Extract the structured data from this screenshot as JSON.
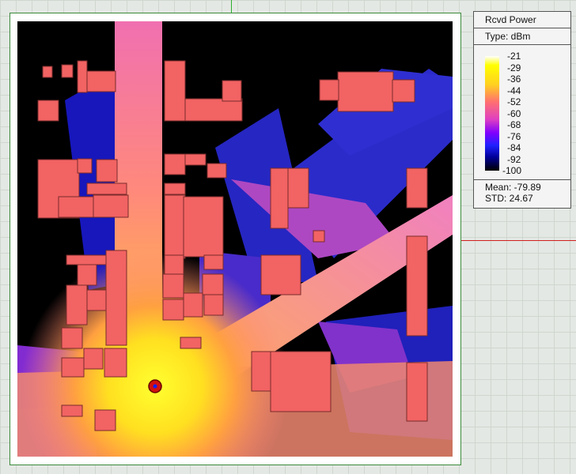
{
  "legend": {
    "title": "Rcvd Power",
    "type_label": "Type: dBm",
    "ticks": [
      "-21",
      "-29",
      "-36",
      "-44",
      "-52",
      "-60",
      "-68",
      "-76",
      "-84",
      "-92",
      "-100"
    ],
    "mean": "Mean: -79.89",
    "std": "STD: 24.67"
  },
  "colors": {
    "building": "#f26363",
    "transmitter": "#d01010",
    "frame": "#3a8a3a"
  }
}
